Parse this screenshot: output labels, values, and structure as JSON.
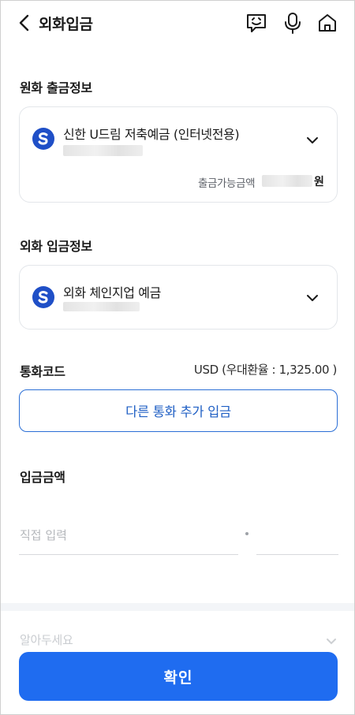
{
  "header": {
    "title": "외화입금",
    "icons": [
      "back-icon",
      "chatbot-icon",
      "mic-icon",
      "home-icon"
    ]
  },
  "krw_section": {
    "title": "원화 출금정보",
    "account_name": "신한 U드림 저축예금 (인터넷전용)",
    "available_label": "출금가능금액",
    "available_unit": "원"
  },
  "fx_section": {
    "title": "외화 입금정보",
    "account_name": "외화 체인지업 예금"
  },
  "currency": {
    "label": "통화코드",
    "value": "USD (우대환율 : 1,325.00 )",
    "add_button": "다른 통화 추가 입금"
  },
  "amount": {
    "title": "입금금액",
    "placeholder": "직접 입력"
  },
  "hidden_row_label": "알아두세요",
  "confirm_button": "확인",
  "colors": {
    "primary": "#1f6cf0",
    "outline": "#2b6fd6",
    "bank_logo": "#1f4fc7"
  }
}
